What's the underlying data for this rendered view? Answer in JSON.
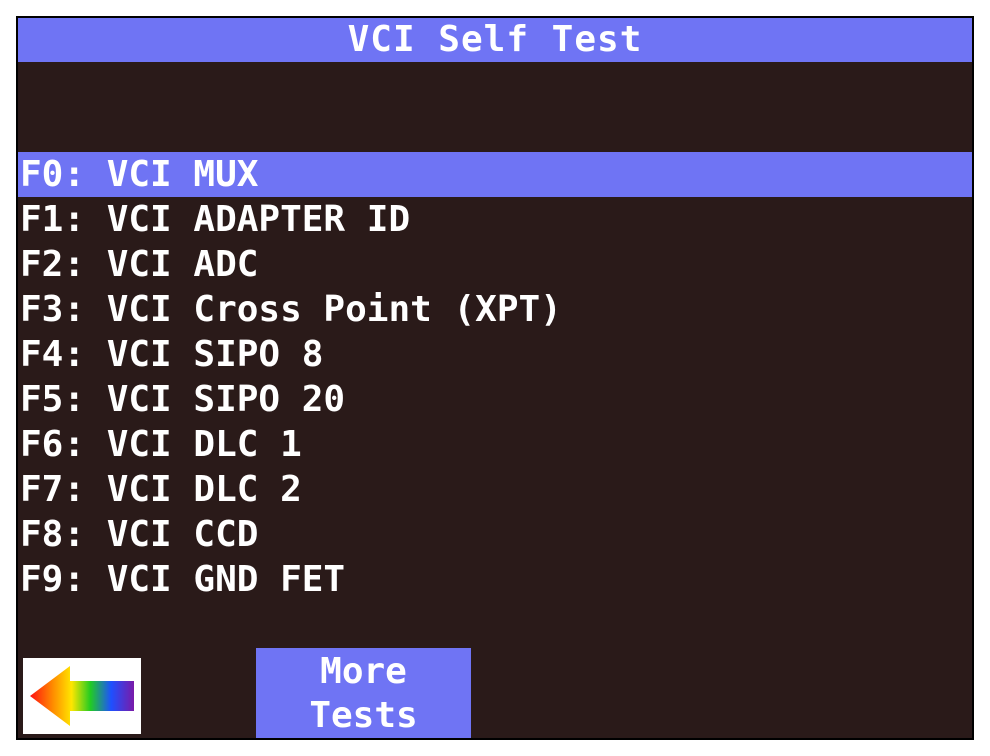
{
  "header": {
    "title": "VCI Self Test"
  },
  "tests": [
    {
      "label": "F0: VCI MUX",
      "selected": true
    },
    {
      "label": "F1: VCI ADAPTER ID",
      "selected": false
    },
    {
      "label": "F2: VCI ADC",
      "selected": false
    },
    {
      "label": "F3: VCI Cross Point (XPT)",
      "selected": false
    },
    {
      "label": "F4: VCI SIPO 8",
      "selected": false
    },
    {
      "label": "F5: VCI SIPO 20",
      "selected": false
    },
    {
      "label": "F6: VCI DLC 1",
      "selected": false
    },
    {
      "label": "F7: VCI DLC 2",
      "selected": false
    },
    {
      "label": "F8: VCI CCD",
      "selected": false
    },
    {
      "label": "F9: VCI GND FET",
      "selected": false
    }
  ],
  "footer": {
    "back_icon": "rainbow-left-arrow-icon",
    "more_line1": "More",
    "more_line2": "Tests"
  },
  "colors": {
    "background": "#2a1a19",
    "highlight": "#6f74f4",
    "text": "#ffffff"
  }
}
